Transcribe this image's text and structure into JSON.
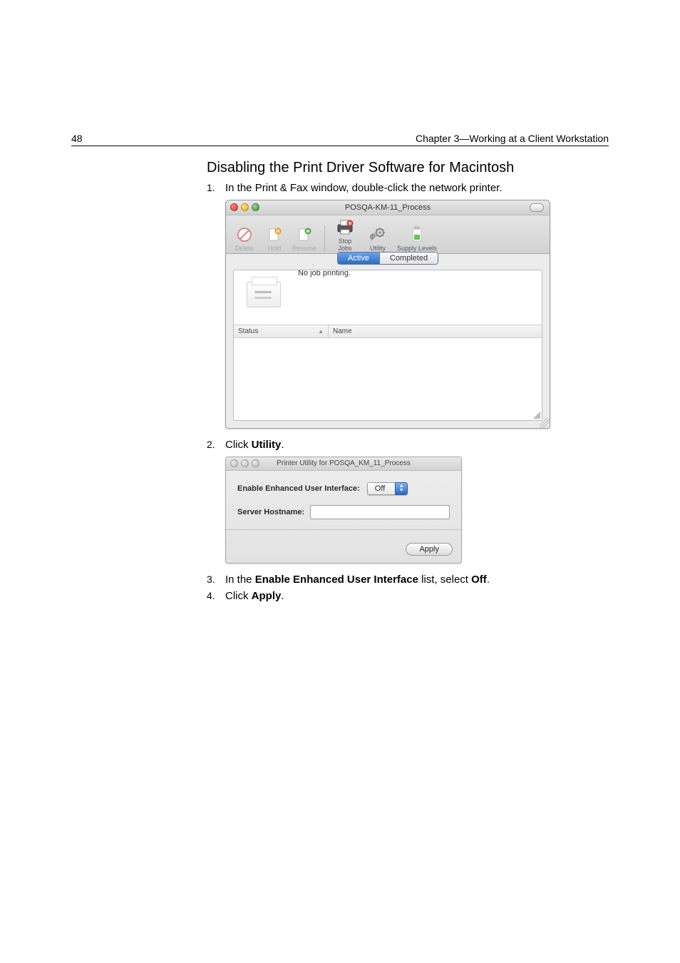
{
  "header": {
    "page_number": "48",
    "chapter": "Chapter 3—Working at a Client Workstation"
  },
  "section_title": "Disabling the Print Driver Software for Macintosh",
  "steps": {
    "s1": {
      "num": "1.",
      "pre": "In the Print & Fax window, double-click the network printer."
    },
    "s2": {
      "num": "2.",
      "pre": "Click ",
      "bold": "Utility",
      "post": "."
    },
    "s3": {
      "num": "3.",
      "pre": "In the ",
      "bold": "Enable Enhanced User Interface",
      "mid": " list, select ",
      "bold2": "Off",
      "post": "."
    },
    "s4": {
      "num": "4.",
      "pre": "Click ",
      "bold": "Apply",
      "post": "."
    }
  },
  "win1": {
    "title": "POSQA-KM-11_Process",
    "toolbar": {
      "delete": "Delete",
      "hold": "Hold",
      "resume": "Resume",
      "stop_jobs": "Stop Jobs",
      "utility": "Utility",
      "supply_levels": "Supply Levels"
    },
    "tabs": {
      "active": "Active",
      "completed": "Completed"
    },
    "no_job": "No job printing.",
    "cols": {
      "status": "Status",
      "name": "Name"
    }
  },
  "win2": {
    "title": "Printer Utility for POSQA_KM_11_Process",
    "enable_label": "Enable Enhanced User Interface:",
    "enable_value": "Off",
    "hostname_label": "Server Hostname:",
    "apply": "Apply"
  }
}
